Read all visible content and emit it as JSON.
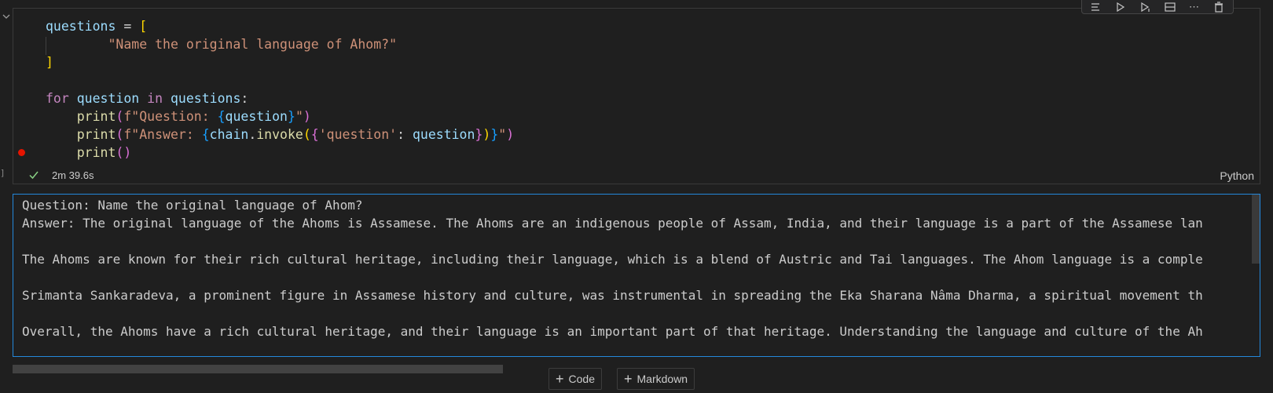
{
  "cell": {
    "code_lines": [
      [
        {
          "t": "questions",
          "c": "var"
        },
        {
          "t": " = ",
          "c": "op"
        },
        {
          "t": "[",
          "c": "br"
        }
      ],
      [
        {
          "t": "        ",
          "c": "op"
        },
        {
          "t": "\"Name the original language of Ahom?\"",
          "c": "str"
        }
      ],
      [
        {
          "t": "]",
          "c": "br"
        }
      ],
      [],
      [
        {
          "t": "for",
          "c": "kw"
        },
        {
          "t": " ",
          "c": "op"
        },
        {
          "t": "question",
          "c": "var"
        },
        {
          "t": " ",
          "c": "op"
        },
        {
          "t": "in",
          "c": "kw"
        },
        {
          "t": " ",
          "c": "op"
        },
        {
          "t": "questions",
          "c": "var"
        },
        {
          "t": ":",
          "c": "op"
        }
      ],
      [
        {
          "t": "    ",
          "c": "op"
        },
        {
          "t": "print",
          "c": "fn"
        },
        {
          "t": "(",
          "c": "br2"
        },
        {
          "t": "f\"Question: ",
          "c": "str"
        },
        {
          "t": "{",
          "c": "br3"
        },
        {
          "t": "question",
          "c": "var"
        },
        {
          "t": "}",
          "c": "br3"
        },
        {
          "t": "\"",
          "c": "str"
        },
        {
          "t": ")",
          "c": "br2"
        }
      ],
      [
        {
          "t": "    ",
          "c": "op"
        },
        {
          "t": "print",
          "c": "fn"
        },
        {
          "t": "(",
          "c": "br2"
        },
        {
          "t": "f\"Answer: ",
          "c": "str"
        },
        {
          "t": "{",
          "c": "br3"
        },
        {
          "t": "chain",
          "c": "var"
        },
        {
          "t": ".",
          "c": "op"
        },
        {
          "t": "invoke",
          "c": "fn"
        },
        {
          "t": "(",
          "c": "br"
        },
        {
          "t": "{",
          "c": "br2"
        },
        {
          "t": "'question'",
          "c": "str"
        },
        {
          "t": ": ",
          "c": "op"
        },
        {
          "t": "question",
          "c": "var"
        },
        {
          "t": "}",
          "c": "br2"
        },
        {
          "t": ")",
          "c": "br"
        },
        {
          "t": "}",
          "c": "br3"
        },
        {
          "t": "\"",
          "c": "str"
        },
        {
          "t": ")",
          "c": "br2"
        }
      ],
      [
        {
          "t": "    ",
          "c": "op"
        },
        {
          "t": "print",
          "c": "fn"
        },
        {
          "t": "()",
          "c": "br2"
        }
      ]
    ],
    "execution_time": "2m 39.6s",
    "language": "Python"
  },
  "output_lines": [
    "Question: Name the original language of Ahom?",
    "Answer: The original language of the Ahoms is Assamese. The Ahoms are an indigenous people of Assam, India, and their language is a part of the Assamese lan",
    "",
    "The Ahoms are known for their rich cultural heritage, including their language, which is a blend of Austric and Tai languages. The Ahom language is a comple",
    "",
    "Srimanta Sankaradeva, a prominent figure in Assamese history and culture, was instrumental in spreading the Eka Sharana Nâma Dharma, a spiritual movement th",
    "",
    "Overall, the Ahoms have a rich cultural heritage, and their language is an important part of that heritage. Understanding the language and culture of the Ah"
  ],
  "add_cell": {
    "code_label": "Code",
    "markdown_label": "Markdown"
  },
  "colors": {
    "accent": "#2488db",
    "success": "#89d185",
    "breakpoint": "#e51400"
  }
}
